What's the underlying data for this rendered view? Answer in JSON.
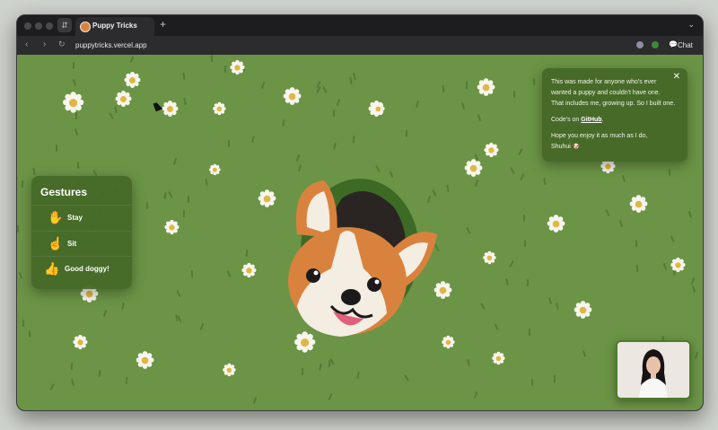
{
  "browser": {
    "tab_title": "Puppy Tricks",
    "new_tab": "+",
    "url": "puppytricks.vercel.app",
    "chat_label": "Chat",
    "icons": {
      "back": "chevron-left-icon",
      "forward": "chevron-right-icon",
      "reload": "reload-icon",
      "tabs_menu": "chevron-down-icon"
    }
  },
  "gestures": {
    "title": "Gestures",
    "items": [
      {
        "icon": "✋",
        "label": "Stay"
      },
      {
        "icon": "☝️",
        "label": "Sit"
      },
      {
        "icon": "👍",
        "label": "Good doggy!"
      }
    ]
  },
  "info": {
    "line1": "This was made for anyone who's ever",
    "line2": "wanted a puppy and couldn't have one.",
    "line3": "That includes me, growing up. So I built one.",
    "code_prefix": "Code's on ",
    "code_link": "GitHub",
    "code_suffix": ".",
    "line5": "Hope you enjoy it as much as I do,",
    "signature": "Shuhui",
    "signature_emoji": "🐶",
    "close": "✕"
  },
  "colors": {
    "lawn": "#6b9446",
    "panel": "#466828",
    "corgi_orange": "#d9823e",
    "corgi_cream": "#f4ede2",
    "tongue": "#e0607a"
  }
}
